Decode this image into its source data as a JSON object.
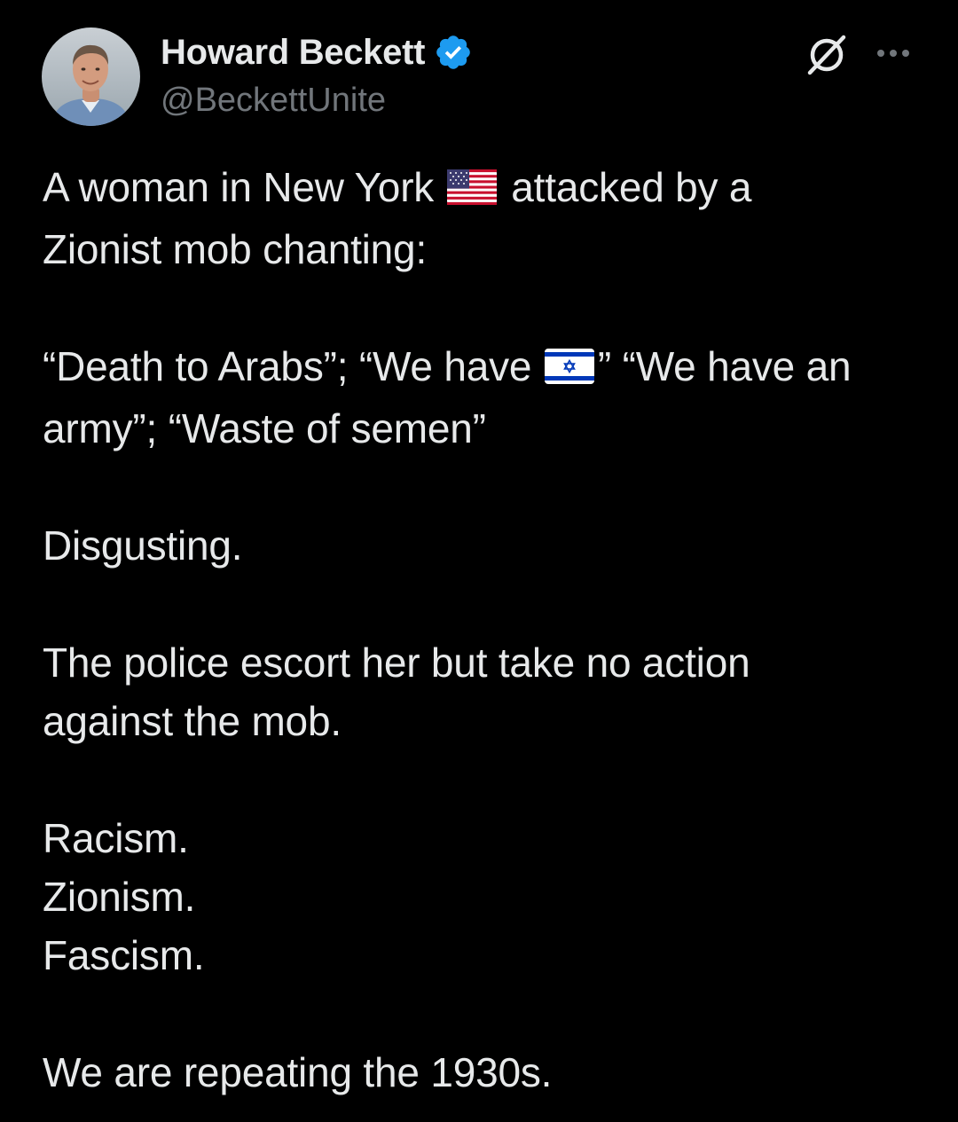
{
  "author": {
    "display_name": "Howard Beckett",
    "handle": "@BeckettUnite",
    "verified": true,
    "avatar_icon": "avatar-photo",
    "badge_color": "#1d9bf0"
  },
  "actions": {
    "grok_icon": "grok-icon",
    "more_icon": "more-options-icon"
  },
  "post": {
    "p1": {
      "line1_before": "A woman in New York",
      "flag1_icon": "us-flag-icon",
      "line1_after": "attacked by a",
      "line2": "Zionist mob chanting:"
    },
    "p2": {
      "line1_before": "“Death to Arabs”; “We have",
      "flag2_icon": "israel-flag-icon",
      "line1_after": "” “We have an",
      "line2": "army”; “Waste of semen”"
    },
    "p3": "Disgusting.",
    "p4": {
      "line1": "The police escort her but take no action",
      "line2": "against the mob."
    },
    "p5": {
      "line1": "Racism.",
      "line2": "Zionism.",
      "line3": "Fascism."
    },
    "p6": "We are repeating the 1930s."
  },
  "colors": {
    "background": "#000000",
    "text_primary": "#e7e9ea",
    "text_secondary": "#71767b"
  }
}
